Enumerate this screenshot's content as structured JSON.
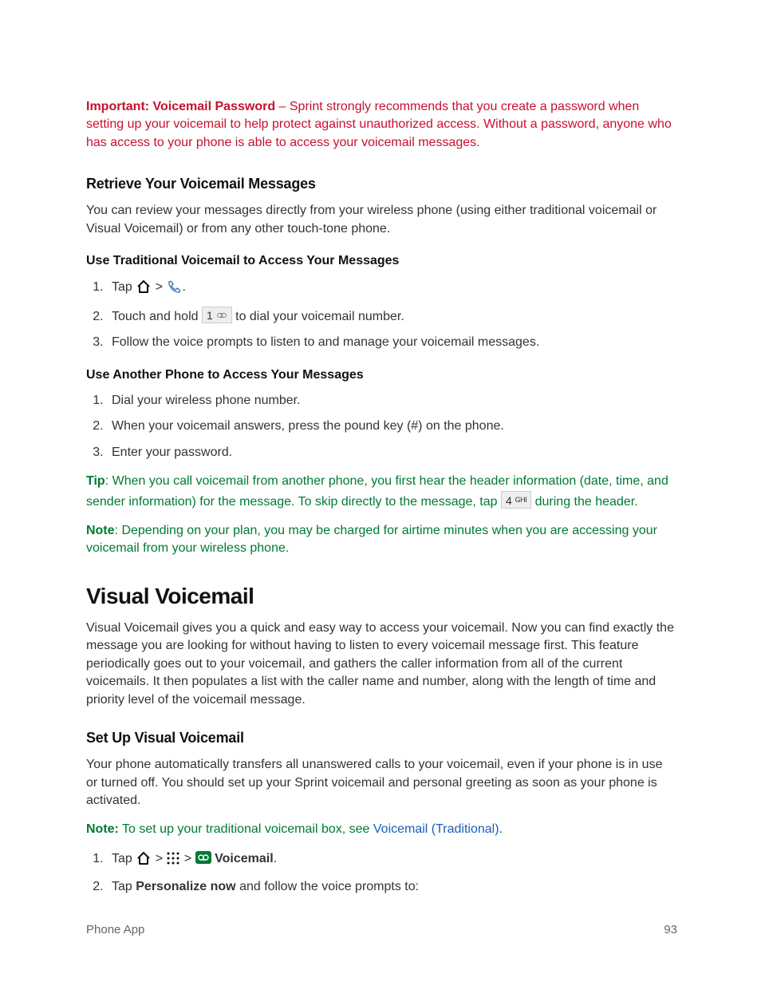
{
  "important": {
    "lead": "Important: Voicemail Password",
    "body": " – Sprint strongly recommends that you create a password when setting up your voicemail to help protect against unauthorized access. Without a password, anyone who has access to your phone is able to access your voicemail messages."
  },
  "retrieve": {
    "heading": "Retrieve Your Voicemail Messages",
    "intro": "You can review your messages directly from your wireless phone (using either traditional voicemail or Visual Voicemail) or from any other touch-tone phone.",
    "trad_heading": "Use Traditional Voicemail to Access Your Messages",
    "trad_steps": {
      "s1_pre": "Tap ",
      "s1_sep": " > ",
      "s1_post": ".",
      "s2_pre": "Touch and hold ",
      "s2_key": "1",
      "s2_post": " to dial your voicemail number.",
      "s3": "Follow the voice prompts to listen to and manage your voicemail messages."
    },
    "other_heading": "Use Another Phone to Access Your Messages",
    "other_steps": {
      "s1": "Dial your wireless phone number.",
      "s2": "When your voicemail answers, press the pound key (#) on the phone.",
      "s3": "Enter your password."
    }
  },
  "tip": {
    "lead": "Tip",
    "body_pre": ": When you call voicemail from another phone, you first hear the header information (date, time, and sender information) for the message. To skip directly to the message, tap ",
    "key_num": "4",
    "key_sub": "GHI",
    "body_post": " during the header."
  },
  "note1": {
    "lead": "Note",
    "body": ": Depending on your plan, you may be charged for airtime minutes when you are accessing your voicemail from your wireless phone."
  },
  "visual": {
    "heading": "Visual Voicemail",
    "intro": "Visual Voicemail gives you a quick and easy way to access your voicemail. Now you can find exactly the message you are looking for without having to listen to every voicemail message first. This feature periodically goes out to your voicemail, and gathers the caller information from all of the current voicemails. It then populates a list with the caller name and number, along with the length of time and priority level of the voicemail message.",
    "setup_heading": "Set Up Visual Voicemail",
    "setup_intro": "Your phone automatically transfers all unanswered calls to your voicemail, even if your phone is in use or turned off. You should set up your Sprint voicemail and personal greeting as soon as your phone is activated.",
    "setup_note_lead": "Note:",
    "setup_note_body": " To set up your traditional voicemail box, see ",
    "setup_note_link": "Voicemail (Traditional)",
    "setup_note_tail": ".",
    "steps": {
      "s1_pre": "Tap ",
      "s1_sep": " > ",
      "s1_label": " Voicemail",
      "s1_post": ".",
      "s2_pre": "Tap ",
      "s2_bold": "Personalize now",
      "s2_post": " and follow the voice prompts to:"
    }
  },
  "footer": {
    "left": "Phone App",
    "right": "93"
  }
}
